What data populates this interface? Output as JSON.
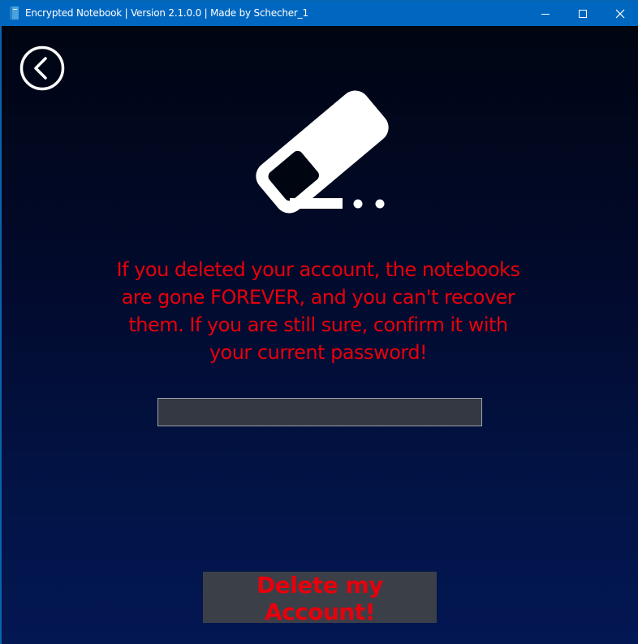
{
  "window": {
    "title": "Encrypted Notebook | Version 2.1.0.0 | Made by Schecher_1",
    "icon": "notebook-icon",
    "controls": [
      "minimize-icon",
      "maximize-icon",
      "close-icon"
    ]
  },
  "page": {
    "back_icon": "back-arrow-icon",
    "hero_icon": "eraser-icon",
    "warning_text": "If you deleted your account, the notebooks are gone FOREVER, and you can't recover them. If you are still sure, confirm it with your current password!",
    "password": {
      "value": "",
      "placeholder": ""
    },
    "delete_button_label": "Delete my Account!"
  },
  "colors": {
    "titlebar": "#0067c0",
    "warning_text": "#e8000b",
    "field_bg": "#343842",
    "button_bg": "#3b3f48"
  }
}
